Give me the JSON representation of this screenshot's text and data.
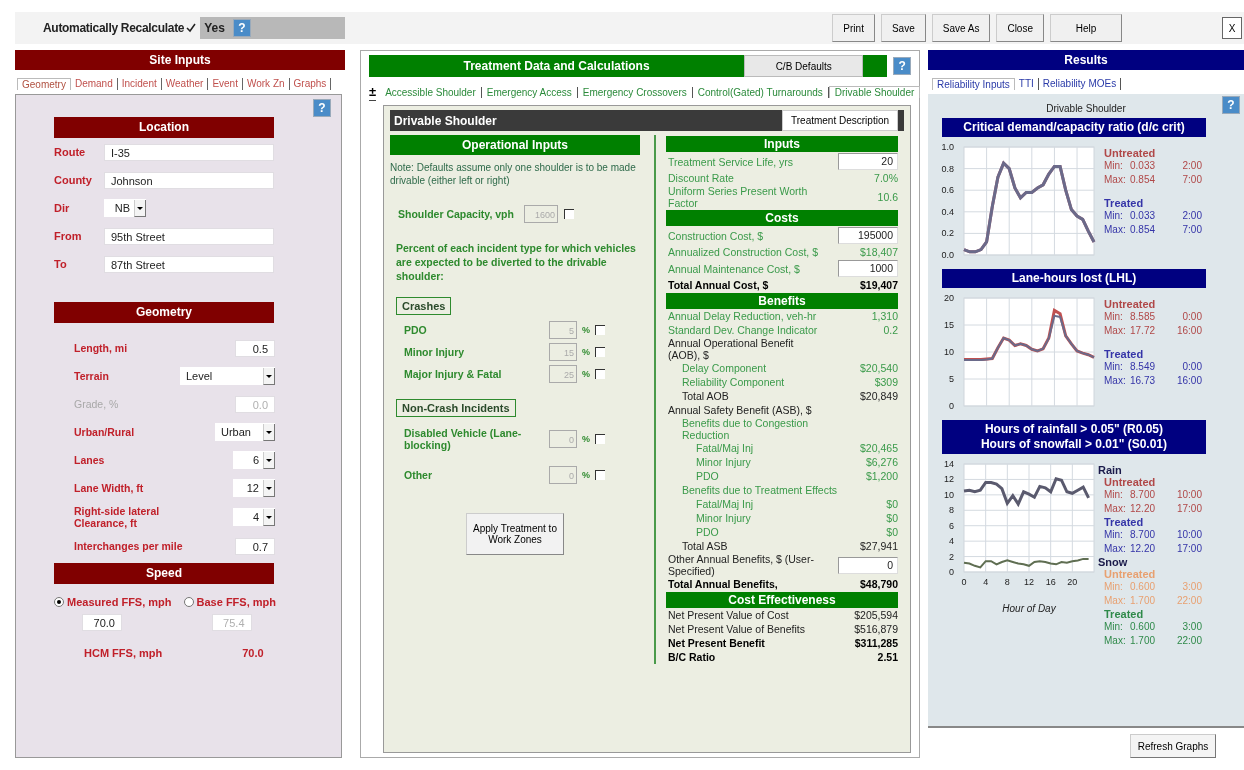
{
  "toolbar": {
    "auto_recalc_label": "Automatically Recalculate",
    "auto_recalc_checked": true,
    "auto_recalc_value": "Yes",
    "help_glyph": "?",
    "buttons": [
      "Print",
      "Save",
      "Save As",
      "Close",
      "Help"
    ],
    "close_label": "X"
  },
  "site_inputs": {
    "title": "Site Inputs",
    "help_glyph": "?",
    "tabs": [
      {
        "label": "Geometry",
        "selected": true
      },
      {
        "label": "Demand",
        "selected": false
      },
      {
        "label": "Incident",
        "selected": false
      },
      {
        "label": "Weather",
        "selected": false
      },
      {
        "label": "Event",
        "selected": false
      },
      {
        "label": "Work Zn",
        "selected": false
      },
      {
        "label": "Graphs",
        "selected": false
      }
    ],
    "location": {
      "title": "Location",
      "fields": [
        {
          "kind": "text",
          "label": "Route",
          "value": "I-35"
        },
        {
          "kind": "text",
          "label": "County",
          "value": "Johnson"
        },
        {
          "kind": "select",
          "label": "Dir",
          "value": "NB"
        },
        {
          "kind": "text",
          "label": "From",
          "value": "95th Street"
        },
        {
          "kind": "text",
          "label": "To",
          "value": "87th Street"
        }
      ]
    },
    "geometry": {
      "title": "Geometry",
      "fields": [
        {
          "kind": "text",
          "label": "Length, mi",
          "value": "0.5",
          "disabled": false
        },
        {
          "kind": "select",
          "label": "Terrain",
          "value": "Level",
          "disabled": false
        },
        {
          "kind": "text",
          "label": "Grade, %",
          "value": "0.0",
          "disabled": true
        },
        {
          "kind": "select",
          "label": "Urban/Rural",
          "value": "Urban",
          "disabled": false
        },
        {
          "kind": "select",
          "label": "Lanes",
          "value": "6",
          "disabled": false
        },
        {
          "kind": "select",
          "label": "Lane Width, ft",
          "value": "12",
          "disabled": false
        },
        {
          "kind": "select",
          "label": "Right-side lateral Clearance, ft",
          "value": "4",
          "disabled": false
        },
        {
          "kind": "text",
          "label": "Interchanges per mile",
          "value": "0.7",
          "disabled": false
        }
      ]
    },
    "speed": {
      "title": "Speed",
      "options": [
        {
          "label": "Measured FFS, mph",
          "selected": true,
          "value": "70.0"
        },
        {
          "label": "Base FFS, mph",
          "selected": false,
          "value": "75.4"
        }
      ],
      "hcm_label": "HCM FFS, mph",
      "hcm_value": "70.0"
    }
  },
  "treatment": {
    "title": "Treatment Data and Calculations",
    "defaults_button": "C/B Defaults",
    "help_glyph": "?",
    "expand_glyph": "±",
    "tabs": [
      {
        "label": "Accessible Shoulder",
        "selected": false
      },
      {
        "label": "Emergency Access",
        "selected": false
      },
      {
        "label": "Emergency Crossovers",
        "selected": false
      },
      {
        "label": "Control(Gated) Turnarounds",
        "selected": false
      },
      {
        "label": "Drivable Shoulder",
        "selected": true
      }
    ],
    "header": "Drivable Shoulder",
    "description_button": "Treatment Description",
    "operational": {
      "title": "Operational Inputs",
      "note": "Note: Defaults assume only one shoulder is to be made drivable (either left or right)",
      "capacity": {
        "label": "Shoulder Capacity, vph",
        "value": "1600",
        "checked": false
      },
      "percent_note": "Percent of each incident type for which vehicles are  expected to be diverted to the drivable shoulder:",
      "groups": [
        {
          "title": "Crashes",
          "rows": [
            {
              "label": "PDO",
              "value": "5",
              "unit": "%",
              "checked": false
            },
            {
              "label": "Minor Injury",
              "value": "15",
              "unit": "%",
              "checked": false
            },
            {
              "label": "Major Injury & Fatal",
              "value": "25",
              "unit": "%",
              "checked": false
            }
          ]
        },
        {
          "title": "Non-Crash Incidents",
          "rows": [
            {
              "label": "Disabled Vehicle (Lane-blocking)",
              "value": "0",
              "unit": "%",
              "checked": false
            },
            {
              "label": "Other",
              "value": "0",
              "unit": "%",
              "checked": false
            }
          ]
        }
      ],
      "apply_button": "Apply Treatment to Work Zones"
    },
    "sections": [
      {
        "title": "Inputs",
        "rows": [
          {
            "kind": "input",
            "label": "Treatment Service Life, yrs",
            "value": "20"
          },
          {
            "kind": "calc",
            "label": "Discount Rate",
            "value": "7.0%"
          },
          {
            "kind": "calc",
            "label": "Uniform Series Present Worth Factor",
            "value": "10.6"
          }
        ]
      },
      {
        "title": "Costs",
        "rows": [
          {
            "kind": "input",
            "label": "Construction Cost, $",
            "value": "195000"
          },
          {
            "kind": "calc",
            "label": "Annualized Construction Cost, $",
            "value": "$18,407"
          },
          {
            "kind": "input",
            "label": "Annual Maintenance Cost, $",
            "value": "1000"
          },
          {
            "kind": "total",
            "label": "Total Annual Cost, $",
            "value": "$19,407"
          }
        ]
      },
      {
        "title": "Benefits",
        "rows": [
          {
            "kind": "calc",
            "label": "Annual Delay Reduction, veh-hr",
            "value": "1,310"
          },
          {
            "kind": "calc",
            "label": "Standard Dev. Change Indicator",
            "value": "0.2"
          },
          {
            "kind": "group",
            "label": "Annual Operational Benefit (AOB), $",
            "children": [
              {
                "kind": "calc",
                "label": "Delay Component",
                "value": "$20,540"
              },
              {
                "kind": "calc",
                "label": "Reliability Component",
                "value": "$309"
              },
              {
                "kind": "sum",
                "label": "Total AOB",
                "value": "$20,849"
              }
            ]
          },
          {
            "kind": "group",
            "label": "Annual Safety Benefit (ASB), $",
            "children": [
              {
                "kind": "subgroup",
                "label": "Benefits due to Congestion Reduction",
                "children": [
                  {
                    "kind": "calc",
                    "label": "Fatal/Maj Inj",
                    "value": "$20,465"
                  },
                  {
                    "kind": "calc",
                    "label": "Minor Injury",
                    "value": "$6,276"
                  },
                  {
                    "kind": "calc",
                    "label": "PDO",
                    "value": "$1,200"
                  }
                ]
              },
              {
                "kind": "subgroup",
                "label": "Benefits due to Treatment Effects",
                "children": [
                  {
                    "kind": "calc",
                    "label": "Fatal/Maj Inj",
                    "value": "$0"
                  },
                  {
                    "kind": "calc",
                    "label": "Minor Injury",
                    "value": "$0"
                  },
                  {
                    "kind": "calc",
                    "label": "PDO",
                    "value": "$0"
                  }
                ]
              },
              {
                "kind": "sum",
                "label": "Total ASB",
                "value": "$27,941"
              }
            ]
          },
          {
            "kind": "entry",
            "label": "Other Annual Benefits, $ (User-Specified)",
            "value": "0"
          },
          {
            "kind": "total",
            "label": "Total Annual Benefits,",
            "value": "$48,790"
          }
        ]
      },
      {
        "title": "Cost Effectiveness",
        "rows": [
          {
            "kind": "sum",
            "label": "Net Present Value of Cost",
            "value": "$205,594"
          },
          {
            "kind": "sum",
            "label": "Net Present Value of Benefits",
            "value": "$516,879"
          },
          {
            "kind": "total",
            "label": "Net Present Benefit",
            "value": "$311,285"
          },
          {
            "kind": "total",
            "label": "B/C Ratio",
            "value": "2.51"
          }
        ]
      }
    ]
  },
  "results": {
    "title": "Results",
    "help_glyph": "?",
    "tabs": [
      {
        "label": "Reliability Inputs",
        "selected": true
      },
      {
        "label": "TTI",
        "selected": false
      },
      {
        "label": "Reliability MOEs",
        "selected": false
      }
    ],
    "subtitle": "Drivable Shoulder",
    "charts": [
      {
        "title_lines": [
          "Critical demand/capacity ratio (d/c crit)"
        ],
        "legend": [
          {
            "kind": "series",
            "color": "#b04848",
            "lines": [
              {
                "label": "Min:",
                "value": "0.033",
                "time": "2:00"
              },
              {
                "label": "Max:",
                "value": "0.854",
                "time": "7:00"
              }
            ]
          },
          {
            "kind": "series",
            "color": "#3535a8",
            "lines": [
              {
                "label": "Min:",
                "value": "0.033",
                "time": "2:00"
              },
              {
                "label": "Max:",
                "value": "0.854",
                "time": "7:00"
              }
            ]
          }
        ],
        "chart_data": {
          "type": "line",
          "grid": true,
          "categories": [
            null,
            null,
            null,
            null,
            null,
            null,
            null,
            null,
            null,
            null,
            null,
            null,
            null,
            null,
            null,
            null,
            null,
            null,
            null,
            null,
            null,
            null,
            null,
            null
          ],
          "ylim": [
            0,
            1
          ],
          "yticks": [
            {
              "value": 0,
              "label": "0.0"
            },
            {
              "value": 0.2,
              "label": "0.2"
            },
            {
              "value": 0.4,
              "label": "0.4"
            },
            {
              "value": 0.6,
              "label": "0.6"
            },
            {
              "value": 0.8,
              "label": "0.8"
            },
            {
              "value": 1,
              "label": "1.0"
            }
          ],
          "series": [
            {
              "name": "Untreated",
              "color": "#b06070",
              "values": [
                0.05,
                0.03,
                0.03,
                0.05,
                0.12,
                0.45,
                0.72,
                0.85,
                0.8,
                0.62,
                0.53,
                0.58,
                0.58,
                0.62,
                0.65,
                0.75,
                0.82,
                0.82,
                0.6,
                0.42,
                0.36,
                0.33,
                0.22,
                0.12
              ]
            },
            {
              "name": "Treated",
              "color": "#6a6a8a",
              "values": [
                0.05,
                0.03,
                0.03,
                0.05,
                0.12,
                0.45,
                0.72,
                0.85,
                0.8,
                0.62,
                0.53,
                0.58,
                0.58,
                0.62,
                0.65,
                0.75,
                0.82,
                0.82,
                0.6,
                0.42,
                0.36,
                0.33,
                0.22,
                0.12
              ]
            }
          ]
        }
      },
      {
        "title_lines": [
          "Lane-hours lost (LHL)"
        ],
        "legend": [
          {
            "kind": "series",
            "color": "#b04848",
            "lines": [
              {
                "label": "Min:",
                "value": "8.585",
                "time": "0:00"
              },
              {
                "label": "Max:",
                "value": "17.72",
                "time": "16:00"
              }
            ]
          },
          {
            "kind": "series",
            "color": "#3535a8",
            "lines": [
              {
                "label": "Min:",
                "value": "8.549",
                "time": "0:00"
              },
              {
                "label": "Max:",
                "value": "16.73",
                "time": "16:00"
              }
            ]
          }
        ],
        "chart_data": {
          "type": "line",
          "grid": true,
          "categories": [
            null,
            null,
            null,
            null,
            null,
            null,
            null,
            null,
            null,
            null,
            null,
            null,
            null,
            null,
            null,
            null,
            null,
            null,
            null,
            null,
            null,
            null,
            null,
            null
          ],
          "ylim": [
            0,
            20
          ],
          "yticks": [
            0,
            5,
            10,
            15,
            20
          ],
          "series": [
            {
              "name": "Untreated",
              "color": "#c05050",
              "values": [
                8.6,
                8.6,
                8.6,
                8.6,
                8.7,
                8.8,
                10.8,
                12.6,
                12.2,
                11.2,
                11.5,
                11.2,
                10.5,
                10.2,
                10.6,
                12.6,
                17.7,
                17.1,
                13,
                11.5,
                10.2,
                9.8,
                9.5,
                9
              ]
            },
            {
              "name": "Treated",
              "color": "#6a6a8a",
              "values": [
                8.5,
                8.5,
                8.5,
                8.5,
                8.6,
                8.8,
                10.8,
                12.6,
                12.2,
                11.2,
                11.5,
                11.2,
                10.5,
                10.2,
                10.6,
                12.5,
                16.7,
                16.5,
                13,
                11.5,
                10.2,
                9.8,
                9.5,
                9
              ]
            }
          ]
        }
      },
      {
        "title_lines": [
          "Hours of rainfall > 0.05\" (R0.05)",
          "Hours of snowfall > 0.01\" (S0.01)"
        ],
        "legend": [
          {
            "kind": "group",
            "items": [
              {
                "heading": "Untreated",
                "color": "#b04848",
                "lines": [
                  {
                    "label": "Min:",
                    "value": "8.700",
                    "time": "10:00"
                  },
                  {
                    "label": "Max:",
                    "value": "12.20",
                    "time": "17:00"
                  }
                ]
              },
              {
                "heading": "Treated",
                "color": "#3535a8",
                "lines": [
                  {
                    "label": "Min:",
                    "value": "8.700",
                    "time": "10:00"
                  },
                  {
                    "label": "Max:",
                    "value": "12.20",
                    "time": "17:00"
                  }
                ]
              }
            ]
          },
          {
            "kind": "group",
            "items": [
              {
                "heading": "Untreated",
                "color": "#e8a070",
                "lines": [
                  {
                    "label": "Min:",
                    "value": "0.600",
                    "time": "3:00"
                  },
                  {
                    "label": "Max:",
                    "value": "1.700",
                    "time": "22:00"
                  }
                ]
              },
              {
                "heading": "Treated",
                "color": "#2f8a4a",
                "lines": [
                  {
                    "label": "Min:",
                    "value": "0.600",
                    "time": "3:00"
                  },
                  {
                    "label": "Max:",
                    "value": "1.700",
                    "time": "22:00"
                  }
                ]
              }
            ]
          }
        ],
        "chart_data": {
          "type": "line",
          "grid": true,
          "xlabel": "Hour of Day",
          "x": [
            0,
            1,
            2,
            3,
            4,
            5,
            6,
            7,
            8,
            9,
            10,
            11,
            12,
            13,
            14,
            15,
            16,
            17,
            18,
            19,
            20,
            21,
            22,
            23
          ],
          "xlim": [
            0,
            24
          ],
          "ylim": [
            0,
            14
          ],
          "xticks": [
            0,
            4,
            8,
            12,
            16,
            20
          ],
          "yticks": [
            0,
            2,
            4,
            6,
            8,
            10,
            12,
            14
          ],
          "series": [
            {
              "name": "Rain",
              "color": "#5a5a6e",
              "values": [
                10.5,
                10.6,
                10.4,
                10.6,
                11.6,
                11.6,
                11.4,
                10.8,
                8.9,
                9.9,
                8.8,
                10.4,
                10.1,
                9.7,
                11.1,
                10.9,
                10.4,
                12.1,
                11.9,
                10.4,
                10.2,
                10.6,
                11,
                9.6
              ]
            },
            {
              "name": "Snow",
              "color": "#5f6e52",
              "values": [
                1.2,
                1.1,
                0.8,
                0.6,
                1.4,
                1.4,
                1,
                1.3,
                1.5,
                1.3,
                1.1,
                1,
                0.8,
                1.3,
                1.4,
                1.3,
                1.1,
                1,
                1.3,
                1.2,
                1.4,
                1.5,
                1.7,
                1.7
              ]
            }
          ]
        }
      }
    ],
    "refresh_button": "Refresh Graphs"
  }
}
